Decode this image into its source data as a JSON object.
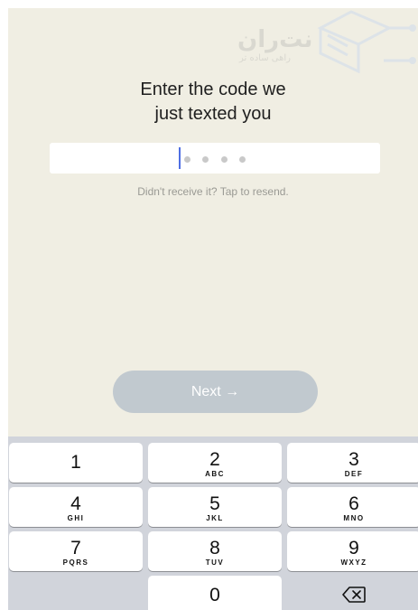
{
  "watermark": {
    "brand": "نت‌ران",
    "tagline": "راهی ساده تر"
  },
  "prompt": {
    "line1": "Enter the code we",
    "line2": "just texted you"
  },
  "code": {
    "length": 4,
    "filled": 0
  },
  "resend_text": "Didn't receive it? Tap to resend.",
  "next_label": "Next →",
  "keypad": [
    {
      "num": "1",
      "letters": ""
    },
    {
      "num": "2",
      "letters": "ABC"
    },
    {
      "num": "3",
      "letters": "DEF"
    },
    {
      "num": "4",
      "letters": "GHI"
    },
    {
      "num": "5",
      "letters": "JKL"
    },
    {
      "num": "6",
      "letters": "MNO"
    },
    {
      "num": "7",
      "letters": "PQRS"
    },
    {
      "num": "8",
      "letters": "TUV"
    },
    {
      "num": "9",
      "letters": "WXYZ"
    },
    {
      "num": "0",
      "letters": ""
    }
  ],
  "colors": {
    "background": "#f0eee3",
    "cursor": "#4f6fe3",
    "next_button": "#c1c9cf",
    "keyboard": "#d1d4db"
  }
}
